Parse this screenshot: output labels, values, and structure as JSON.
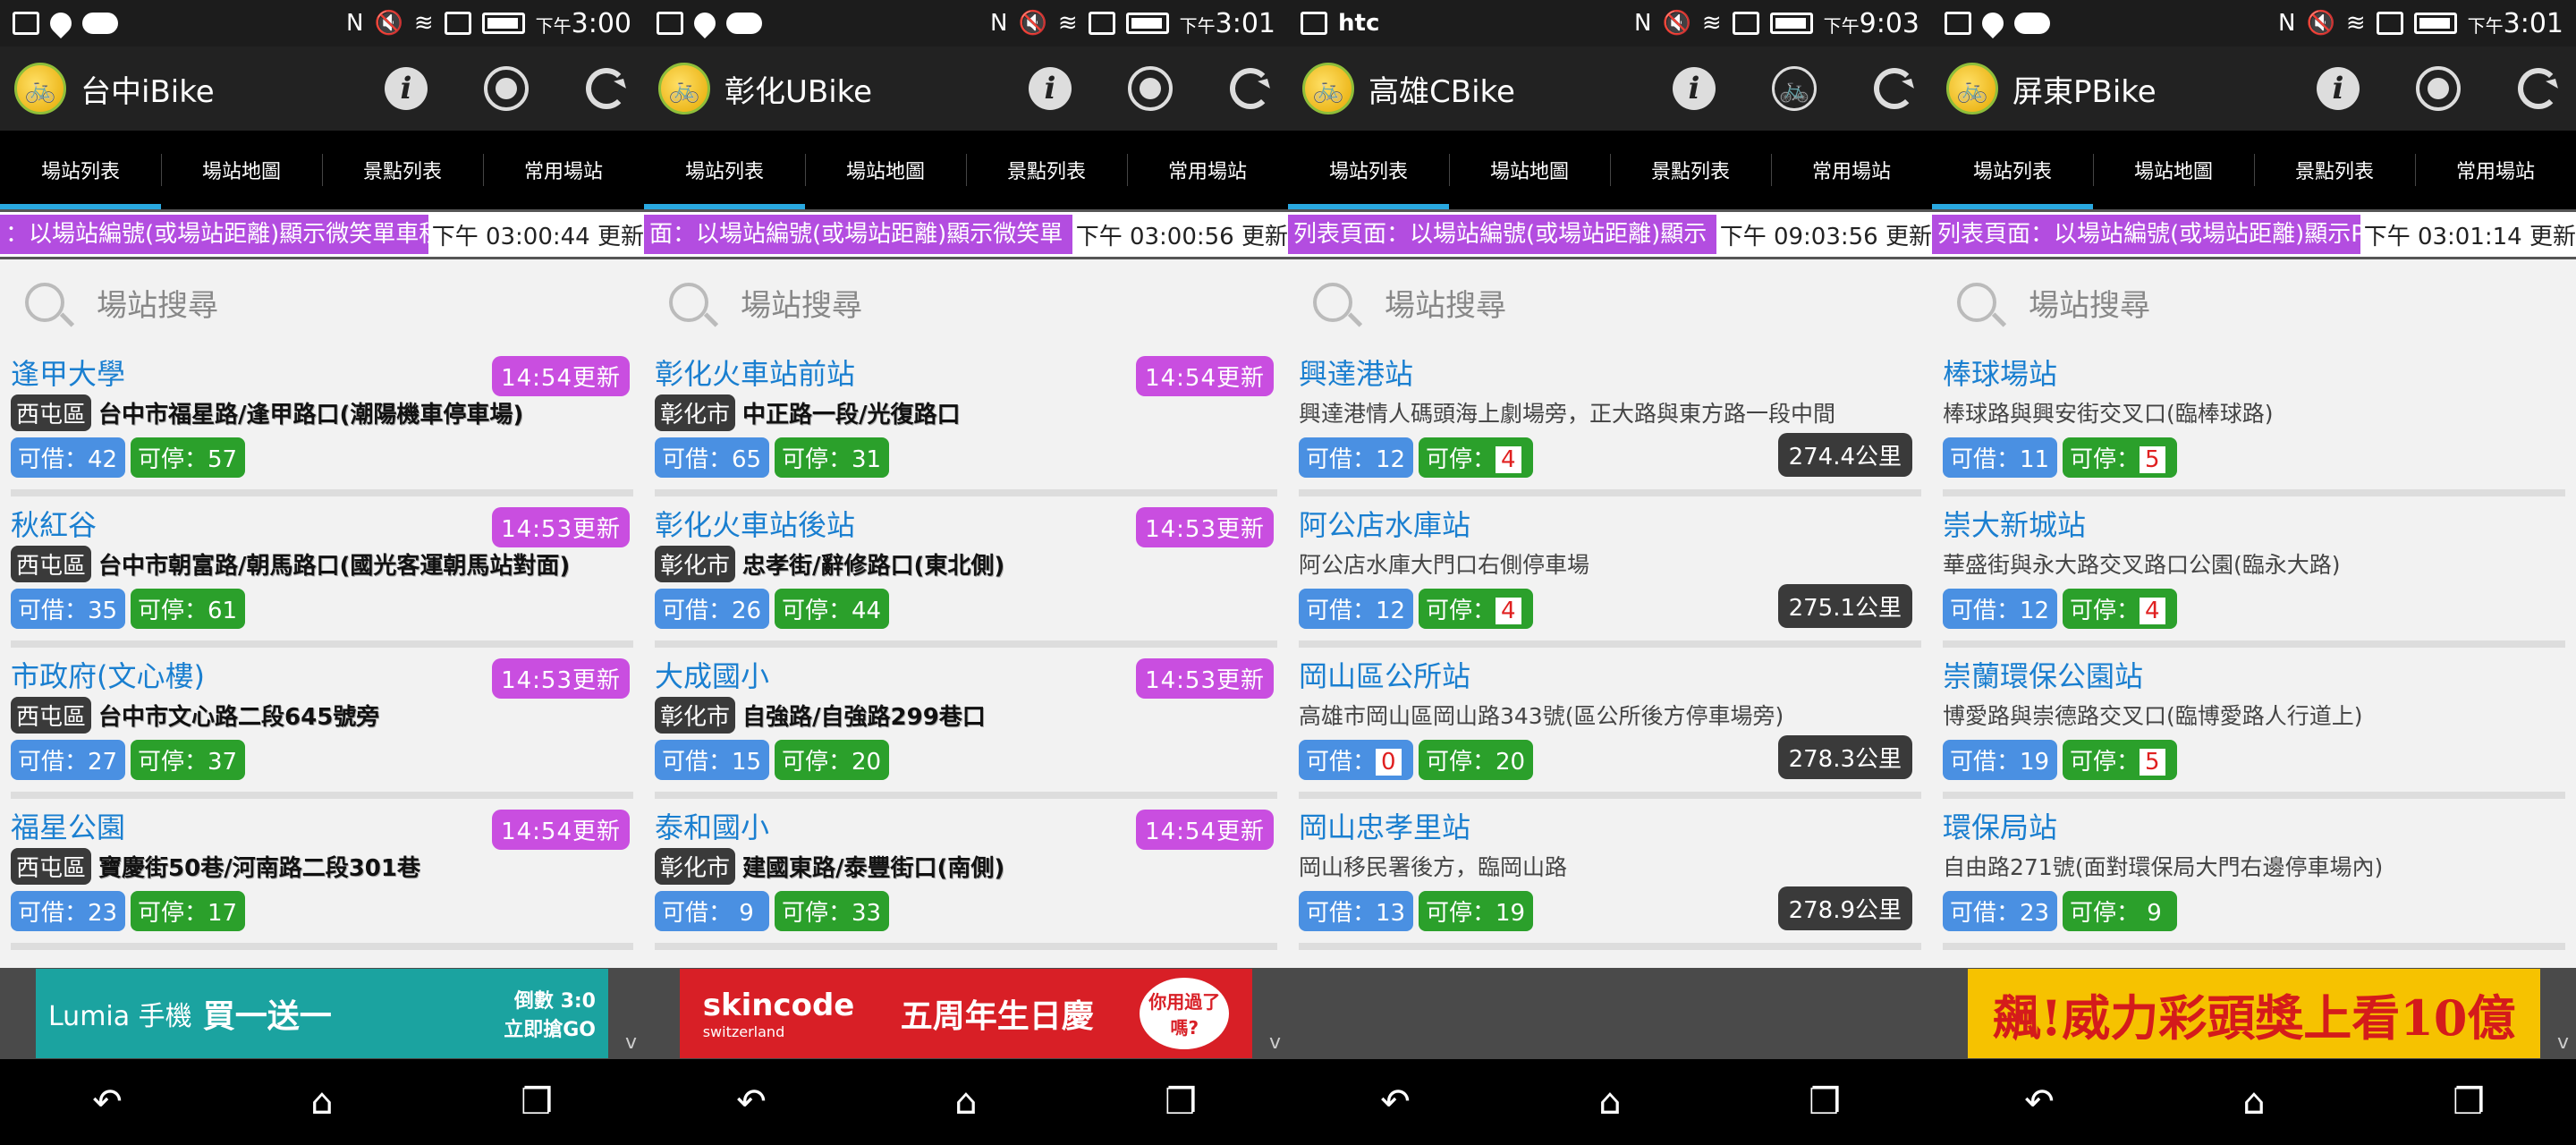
{
  "screens": [
    {
      "status": {
        "left": [
          "msg",
          "loc",
          "cloud"
        ],
        "time_prefix": "下午",
        "time": "3:00"
      },
      "app_title": "台中iBike",
      "actions": [
        "info-icon",
        "locate-icon",
        "refresh-icon"
      ],
      "tabs": [
        "場站列表",
        "場站地圖",
        "景點列表",
        "常用場站"
      ],
      "ticker": {
        "message": "：以場站編號(或場站距離)顯示微笑單車租",
        "updated": "下午 03:00:44 更新"
      },
      "search_placeholder": "場站搜尋",
      "stations": [
        {
          "name": "逢甲大學",
          "updated": "14:54更新",
          "district": "西屯區",
          "address": "台中市福星路/逢甲路口(潮陽機車停車場)",
          "borrow": "可借：42",
          "park": "可停：57"
        },
        {
          "name": "秋紅谷",
          "updated": "14:53更新",
          "district": "西屯區",
          "address": "台中市朝富路/朝馬路口(國光客運朝馬站對面)",
          "borrow": "可借：35",
          "park": "可停：61"
        },
        {
          "name": "市政府(文心樓)",
          "updated": "14:53更新",
          "district": "西屯區",
          "address": "台中市文心路二段645號旁",
          "borrow": "可借：27",
          "park": "可停：37"
        },
        {
          "name": "福星公園",
          "updated": "14:54更新",
          "district": "西屯區",
          "address": "寶慶街50巷/河南路二段301巷",
          "borrow": "可借：23",
          "park": "可停：17"
        }
      ],
      "ad": {
        "type": "lumia",
        "brand": "Lumia 手機",
        "offer": "買一送一",
        "price": "倒數 3:0",
        "cta": "立即搶GO"
      }
    },
    {
      "status": {
        "left": [
          "msg",
          "loc",
          "cloud"
        ],
        "time_prefix": "下午",
        "time": "3:01"
      },
      "app_title": "彰化UBike",
      "actions": [
        "info-icon",
        "locate-icon",
        "refresh-icon"
      ],
      "tabs": [
        "場站列表",
        "場站地圖",
        "景點列表",
        "常用場站"
      ],
      "ticker": {
        "message": "面：以場站編號(或場站距離)顯示微笑單",
        "updated": "下午 03:00:56 更新"
      },
      "search_placeholder": "場站搜尋",
      "stations": [
        {
          "name": "彰化火車站前站",
          "updated": "14:54更新",
          "district": "彰化市",
          "address": "中正路一段/光復路口",
          "borrow": "可借：65",
          "park": "可停：31"
        },
        {
          "name": "彰化火車站後站",
          "updated": "14:53更新",
          "district": "彰化市",
          "address": "忠孝街/辭修路口(東北側)",
          "borrow": "可借：26",
          "park": "可停：44"
        },
        {
          "name": "大成國小",
          "updated": "14:53更新",
          "district": "彰化市",
          "address": "自強路/自強路299巷口",
          "borrow": "可借：15",
          "park": "可停：20"
        },
        {
          "name": "泰和國小",
          "updated": "14:54更新",
          "district": "彰化市",
          "address": "建國東路/泰豐街口(南側)",
          "borrow": "可借： 9",
          "park": "可停：33"
        }
      ],
      "ad": {
        "type": "skincode",
        "brand": "skincode",
        "sub": "switzerland",
        "offer": "五周年生日慶",
        "bubble": "你用過了嗎?"
      }
    },
    {
      "status": {
        "left": [
          "msg",
          "htc"
        ],
        "htc": "htc",
        "time_prefix": "下午",
        "time": "9:03"
      },
      "app_title": "高雄CBike",
      "actions": [
        "info-icon",
        "bike-icon",
        "refresh-icon"
      ],
      "tabs": [
        "場站列表",
        "場站地圖",
        "景點列表",
        "常用場站"
      ],
      "ticker": {
        "message": "列表頁面：以場站編號(或場站距離)顯示",
        "updated": "下午 09:03:56 更新"
      },
      "search_placeholder": "場站搜尋",
      "stations": [
        {
          "name": "興達港站",
          "address": "興達港情人碼頭海上劇場旁，正大路與東方路一段中間",
          "borrow": "可借：12",
          "park_label": "可停：",
          "park_num": "4",
          "distance": "274.4公里"
        },
        {
          "name": "阿公店水庫站",
          "address": "阿公店水庫大門口右側停車場",
          "borrow": "可借：12",
          "park_label": "可停：",
          "park_num": "4",
          "distance": "275.1公里"
        },
        {
          "name": "岡山區公所站",
          "address": "高雄市岡山區岡山路343號(區公所後方停車場旁)",
          "borrow_label": "可借：",
          "borrow_num": "0",
          "park": "可停：20",
          "distance": "278.3公里"
        },
        {
          "name": "岡山忠孝里站",
          "address": "岡山移民署後方，臨岡山路",
          "borrow": "可借：13",
          "park": "可停：19",
          "distance": "278.9公里"
        }
      ],
      "ad": {
        "type": "none"
      }
    },
    {
      "status": {
        "left": [
          "msg",
          "loc",
          "cloud"
        ],
        "time_prefix": "下午",
        "time": "3:01"
      },
      "app_title": "屏東PBike",
      "actions": [
        "info-icon",
        "locate-icon",
        "refresh-icon"
      ],
      "tabs": [
        "場站列表",
        "場站地圖",
        "景點列表",
        "常用場站"
      ],
      "ticker": {
        "message": "列表頁面：以場站編號(或場站距離)顯示P",
        "updated": "下午 03:01:14 更新"
      },
      "search_placeholder": "場站搜尋",
      "stations": [
        {
          "name": "棒球場站",
          "address": "棒球路與興安街交叉口(臨棒球路)",
          "borrow": "可借：11",
          "park_label": "可停：",
          "park_num": "5"
        },
        {
          "name": "崇大新城站",
          "address": "華盛街與永大路交叉路口公園(臨永大路)",
          "borrow": "可借：12",
          "park_label": "可停：",
          "park_num": "4"
        },
        {
          "name": "崇蘭環保公園站",
          "address": "博愛路與崇德路交叉口(臨博愛路人行道上)",
          "borrow": "可借：19",
          "park_label": "可停：",
          "park_num": "5"
        },
        {
          "name": "環保局站",
          "address": "自由路271號(面對環保局大門右邊停車場內)",
          "borrow": "可借：23",
          "park": "可停： 9"
        }
      ],
      "ad": {
        "type": "lotto",
        "text": "飆!威力彩頭獎上看10億"
      }
    }
  ],
  "colors": {
    "accent": "#29a8e0",
    "update_badge": "#c94ee0",
    "borrow": "#4a90e2",
    "park": "#2ba02b",
    "name": "#1a7fd0"
  }
}
